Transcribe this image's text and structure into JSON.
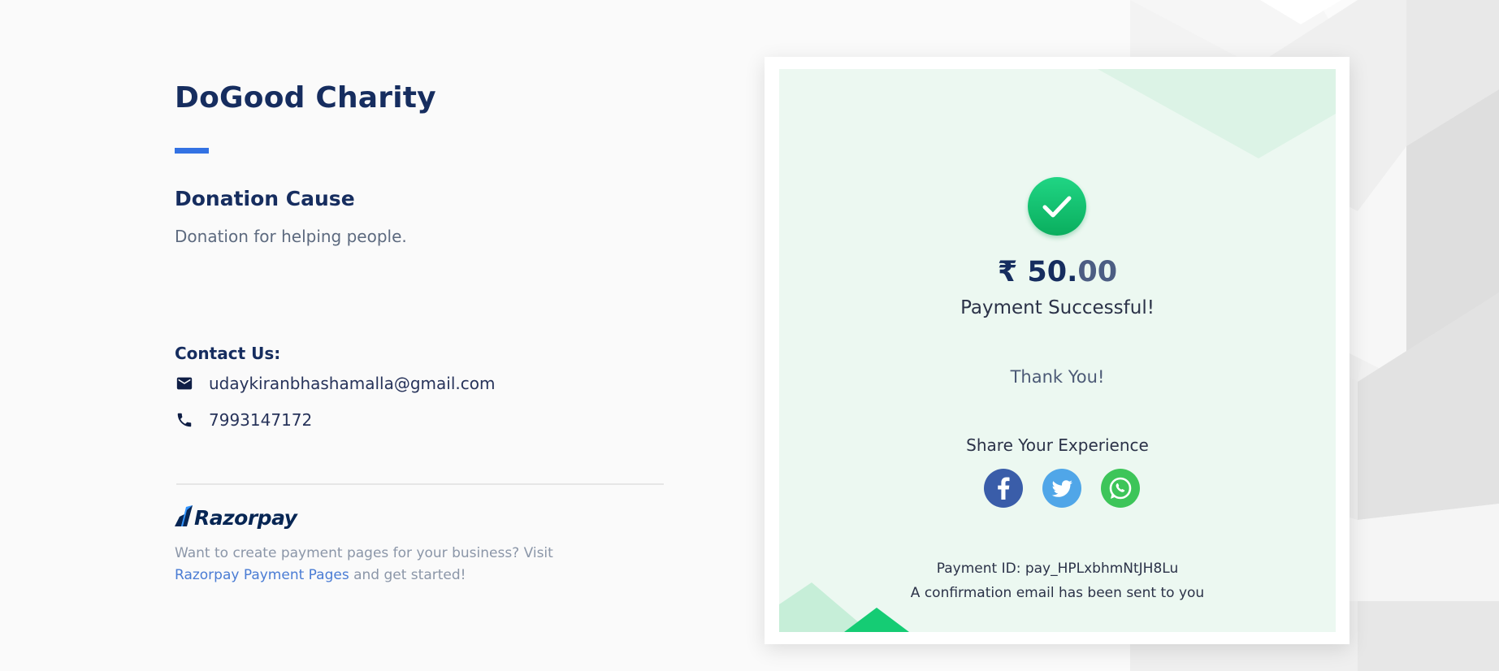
{
  "merchant": {
    "name": "DoGood Charity"
  },
  "cause": {
    "title": "Donation Cause",
    "description": "Donation for helping people."
  },
  "contact": {
    "title": "Contact Us:",
    "email": "udaykiranbhashamalla@gmail.com",
    "email_icon": "mail-icon",
    "phone": "7993147172",
    "phone_icon": "phone-icon"
  },
  "footer": {
    "logo_text": "Razorpay",
    "promo_prefix": "Want to create payment pages for your business? Visit ",
    "promo_link": "Razorpay Payment Pages",
    "promo_suffix": " and get started!"
  },
  "receipt": {
    "amount_whole": "₹ 50.",
    "amount_decimal": "00",
    "status": "Payment Successful!",
    "thanks": "Thank You!",
    "share_title": "Share Your Experience",
    "share_icons": [
      "facebook-icon",
      "twitter-icon",
      "whatsapp-icon"
    ],
    "payment_id": "Payment ID: pay_HPLxbhmNtJH8Lu",
    "confirmation": "A confirmation email has been sent to you"
  },
  "colors": {
    "accent": "#3372e3",
    "heading": "#162d5f",
    "success": "#10c06d",
    "card_bg": "#ecf8f1",
    "facebook": "#3a5da9",
    "twitter": "#50a6e8",
    "whatsapp": "#3dc559"
  }
}
